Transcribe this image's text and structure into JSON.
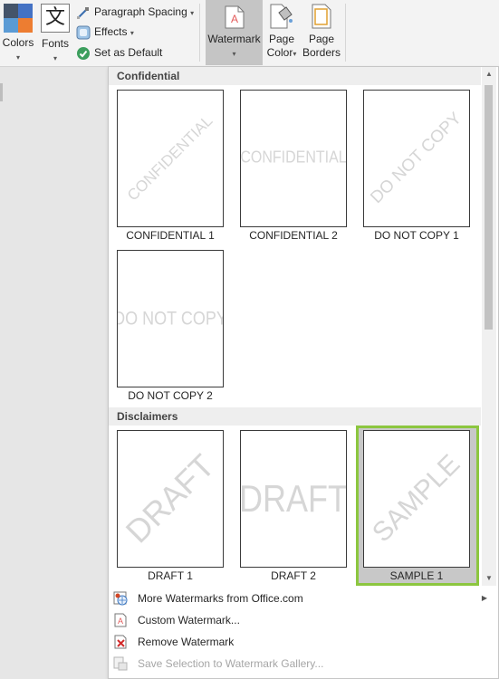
{
  "ribbon": {
    "colors_label": "Colors",
    "fonts_label": "Fonts",
    "fonts_glyph": "文",
    "paragraph_spacing_label": "Paragraph Spacing",
    "effects_label": "Effects",
    "set_default_label": "Set as Default",
    "watermark_label": "Watermark",
    "page_color_label_1": "Page",
    "page_color_label_2": "Color",
    "page_borders_label_1": "Page",
    "page_borders_label_2": "Borders",
    "caret": "▾"
  },
  "gallery": {
    "sections": [
      {
        "title": "Confidential",
        "items": [
          {
            "caption": "CONFIDENTIAL 1",
            "watermark": "CONFIDENTIAL",
            "style": "diagonal"
          },
          {
            "caption": "CONFIDENTIAL 2",
            "watermark": "CONFIDENTIAL",
            "style": "horizontal"
          },
          {
            "caption": "DO NOT COPY 1",
            "watermark": "DO NOT COPY",
            "style": "diagonal"
          },
          {
            "caption": "DO NOT COPY 2",
            "watermark": "DO NOT COPY",
            "style": "horizontal"
          }
        ]
      },
      {
        "title": "Disclaimers",
        "items": [
          {
            "caption": "DRAFT 1",
            "watermark": "DRAFT",
            "style": "diagonal"
          },
          {
            "caption": "DRAFT 2",
            "watermark": "DRAFT",
            "style": "horizontal"
          },
          {
            "caption": "SAMPLE 1",
            "watermark": "SAMPLE",
            "style": "diagonal",
            "selected": true
          }
        ]
      }
    ]
  },
  "menu": {
    "more_watermarks": "More Watermarks from Office.com",
    "custom_watermark": "Custom Watermark...",
    "remove_watermark": "Remove Watermark",
    "save_selection": "Save Selection to Watermark Gallery..."
  },
  "colors": {
    "selection_outline": "#8cc63f",
    "selected_fill": "#c8c8c8",
    "active_ribbon_button": "#c5c5c5",
    "watermark_text": "#d6d6d6"
  },
  "icons": {
    "colors": "color-palette-icon",
    "fonts": "fonts-icon",
    "paragraph_spacing": "paragraph-spacing-icon",
    "effects": "effects-icon",
    "set_default": "checkmark-icon",
    "watermark": "watermark-icon",
    "page_color": "page-color-icon",
    "page_borders": "page-borders-icon",
    "more_watermarks": "office-web-icon",
    "custom_watermark": "custom-watermark-icon",
    "remove_watermark": "remove-watermark-icon",
    "save_selection": "save-gallery-icon",
    "scroll_up": "scroll-up-arrow-icon",
    "scroll_down": "scroll-down-arrow-icon",
    "submenu": "submenu-arrow-icon"
  }
}
